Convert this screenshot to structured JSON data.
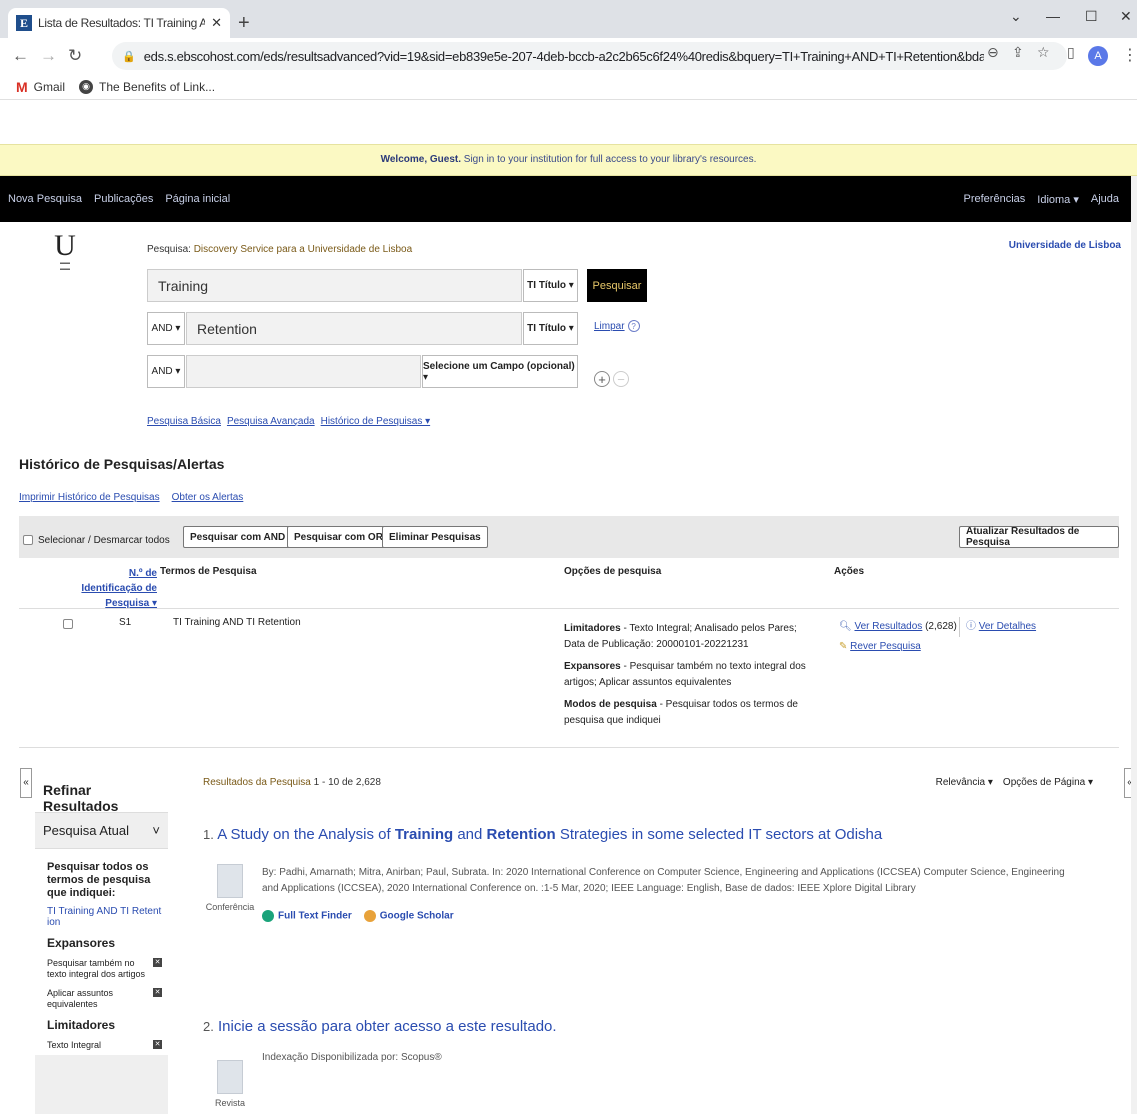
{
  "browser": {
    "tab_title": "Lista de Resultados: TI Training A",
    "favicon_letter": "E",
    "url": "eds.s.ebscohost.com/eds/resultsadvanced?vid=19&sid=eb839e5e-207-4deb-bccb-a2c2b65c6f24%40redis&bquery=TI+Training+AND+TI+Retention&bdata=Jk...",
    "avatar_letter": "A",
    "bookmarks": [
      "Gmail",
      "The Benefits of Link..."
    ]
  },
  "welcome": {
    "bold": "Welcome, Guest.",
    "rest": " Sign in to your institution for full access to your library's resources."
  },
  "topnav": {
    "left": [
      "Nova Pesquisa",
      "Publicações",
      "Página inicial"
    ],
    "right": [
      "Preferências",
      "Idioma ▾",
      "Ajuda"
    ]
  },
  "search": {
    "label_prefix": "Pesquisa:",
    "label_source": "Discovery Service para a Universidade de Lisboa",
    "institution": "Universidade de Lisboa",
    "rows": [
      {
        "bool": "",
        "term": "Training",
        "field": "TI Título ▾"
      },
      {
        "bool": "AND ▾",
        "term": "Retention",
        "field": "TI Título ▾"
      },
      {
        "bool": "AND ▾",
        "term": "",
        "field": "Selecione um Campo (opcional) ▾"
      }
    ],
    "search_button": "Pesquisar",
    "clear_link": "Limpar",
    "links": [
      "Pesquisa Básica",
      "Pesquisa Avançada",
      "Histórico de Pesquisas ▾"
    ]
  },
  "history": {
    "title": "Histórico de Pesquisas/Alertas",
    "links": [
      "Imprimir Histórico de Pesquisas",
      "Obter os Alertas"
    ],
    "select_all": "Selecionar / Desmarcar todos",
    "buttons": [
      "Pesquisar com AND",
      "Pesquisar com OR",
      "Eliminar Pesquisas"
    ],
    "update_button": "Atualizar Resultados de Pesquisa",
    "columns": [
      "N.º de Identificação de Pesquisa ▾",
      "Termos de Pesquisa",
      "Opções de pesquisa",
      "Ações"
    ],
    "row": {
      "id": "S1",
      "terms": "TI Training AND TI Retention",
      "limiters_label": "Limitadores",
      "limiters": " - Texto Integral; Analisado pelos Pares; Data de Publicação: 20000101-20221231",
      "expanders_label": "Expansores",
      "expanders": " - Pesquisar também no texto integral dos artigos; Aplicar assuntos equivalentes",
      "modes_label": "Modos de pesquisa",
      "modes": " - Pesquisar todos os termos de pesquisa que indiquei",
      "view_results": "Ver Resultados",
      "view_results_count": " (2,628)",
      "view_details": "Ver Detalhes",
      "revise": "Rever Pesquisa"
    }
  },
  "refine": {
    "title": "Refinar Resultados",
    "current": "Pesquisa Atual",
    "all_terms": "Pesquisar todos os termos de pesquisa que indiquei:",
    "query": "TI Training AND TI Retention",
    "expanders_title": "Expansores",
    "expanders": [
      "Pesquisar também no texto integral dos artigos",
      "Aplicar assuntos equivalentes"
    ],
    "limiters_title": "Limitadores",
    "limiters": [
      "Texto Integral"
    ]
  },
  "results": {
    "count_label": "Resultados da Pesquisa",
    "count_value": " 1 - 10 de 2,628",
    "sort": "Relevância ▾",
    "page_options": "Opções de Página ▾",
    "items": [
      {
        "num": "1.",
        "title_pre": "A Study on the Analysis of ",
        "title_b1": "Training",
        "title_mid": " and ",
        "title_b2": "Retention",
        "title_post": " Strategies in some selected IT sectors at Odisha",
        "meta": "By: Padhi, Amarnath; Mitra, Anirban; Paul, Subrata. In: 2020 International Conference on Computer Science, Engineering and Applications (ICCSEA) Computer Science, Engineering and Applications (ICCSEA), 2020 International Conference on. :1-5 Mar, 2020; IEEE Language: English, Base de dados: IEEE Xplore Digital Library",
        "type": "Conferência",
        "links": [
          "Full Text Finder",
          "Google Scholar"
        ]
      },
      {
        "num": "2.",
        "title": "Inicie a sessão para obter acesso a este resultado.",
        "meta": "Indexação Disponibilizada por:  Scopus®",
        "type": "Revista"
      }
    ]
  }
}
